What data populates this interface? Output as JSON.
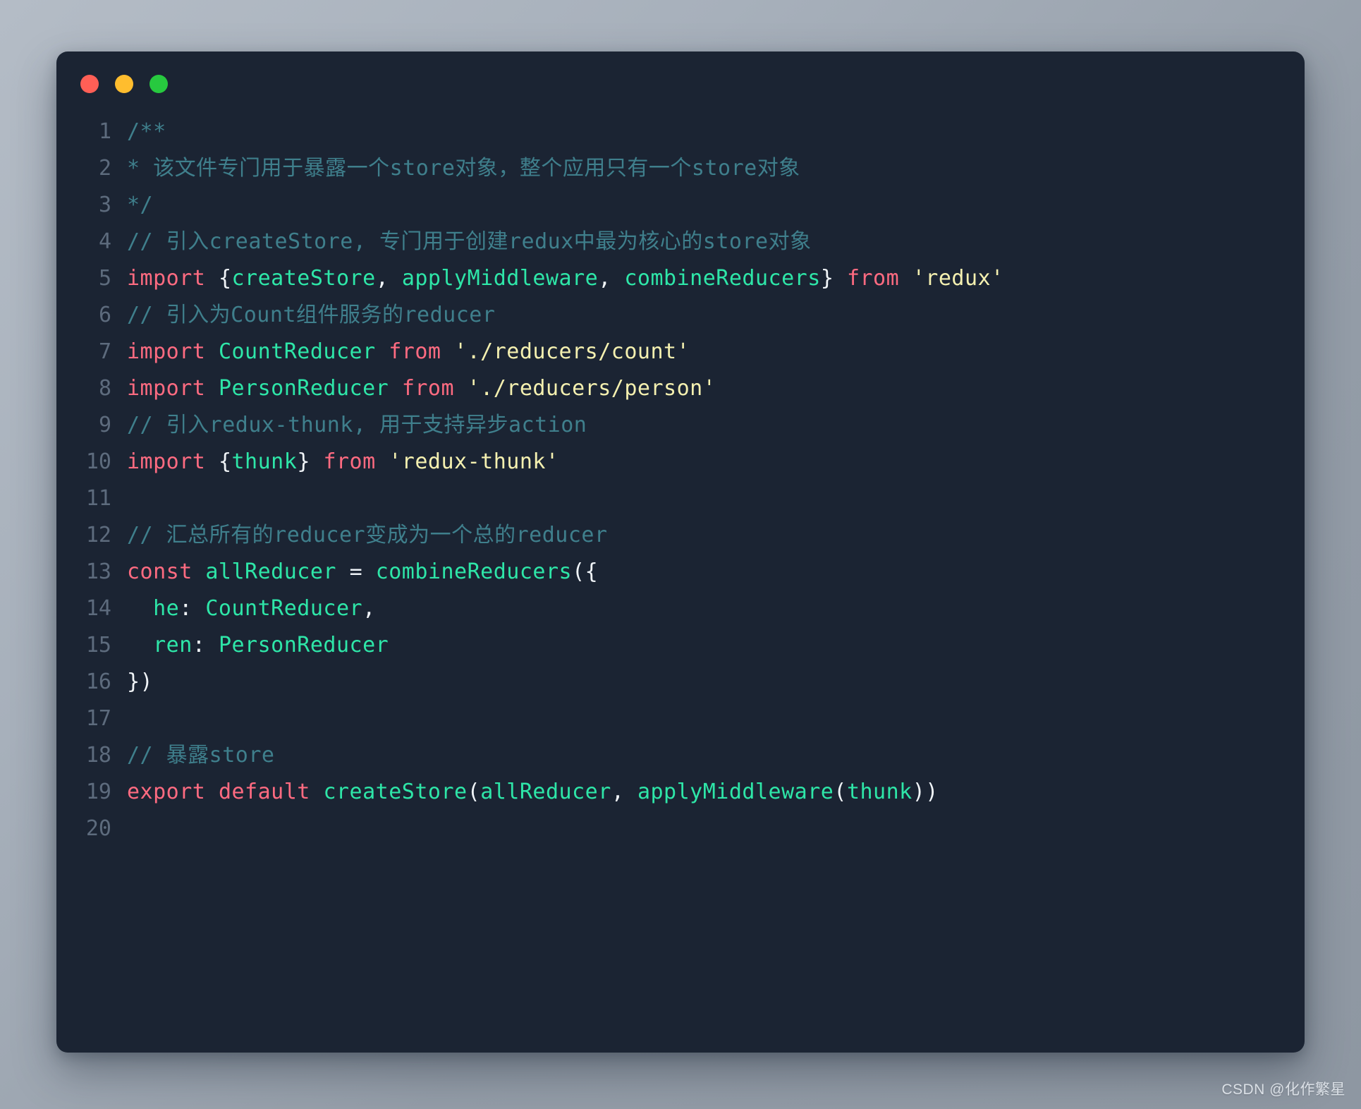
{
  "window": {
    "background_color": "#1b2433",
    "traffic_lights": [
      {
        "name": "close",
        "color": "#ff5f56",
        "label": ""
      },
      {
        "name": "minimize",
        "color": "#ffbd2e",
        "label": ""
      },
      {
        "name": "maximize",
        "color": "#27c93f",
        "label": ""
      }
    ]
  },
  "editor": {
    "language": "javascript",
    "theme": "dark-navy",
    "total_lines": 20,
    "lines": [
      {
        "number": "1",
        "text": "/**",
        "tokens": [
          {
            "t": "/**",
            "c": "comment"
          }
        ]
      },
      {
        "number": "2",
        "text": "* 该文件专门用于暴露一个store对象，整个应用只有一个store对象",
        "tokens": [
          {
            "t": "* 该文件专门用于暴露一个store对象，整个应用只有一个store对象",
            "c": "comment"
          }
        ]
      },
      {
        "number": "3",
        "text": "*/",
        "tokens": [
          {
            "t": "*/",
            "c": "comment"
          }
        ]
      },
      {
        "number": "4",
        "text": "// 引入createStore, 专门用于创建redux中最为核心的store对象",
        "tokens": [
          {
            "t": "// 引入createStore, 专门用于创建redux中最为核心的store对象",
            "c": "comment"
          }
        ]
      },
      {
        "number": "5",
        "text": "import {createStore, applyMiddleware, combineReducers} from 'redux'",
        "tokens": [
          {
            "t": "import",
            "c": "keyword"
          },
          {
            "t": " ",
            "c": "plain"
          },
          {
            "t": "{",
            "c": "punct"
          },
          {
            "t": "createStore",
            "c": "ident"
          },
          {
            "t": ",",
            "c": "punct"
          },
          {
            "t": " ",
            "c": "plain"
          },
          {
            "t": "applyMiddleware",
            "c": "ident"
          },
          {
            "t": ",",
            "c": "punct"
          },
          {
            "t": " ",
            "c": "plain"
          },
          {
            "t": "combineReducers",
            "c": "ident"
          },
          {
            "t": "}",
            "c": "punct"
          },
          {
            "t": " ",
            "c": "plain"
          },
          {
            "t": "from",
            "c": "keyword"
          },
          {
            "t": " ",
            "c": "plain"
          },
          {
            "t": "'redux'",
            "c": "string"
          }
        ]
      },
      {
        "number": "6",
        "text": "// 引入为Count组件服务的reducer",
        "tokens": [
          {
            "t": "// 引入为Count组件服务的reducer",
            "c": "comment"
          }
        ]
      },
      {
        "number": "7",
        "text": "import CountReducer from './reducers/count'",
        "tokens": [
          {
            "t": "import",
            "c": "keyword"
          },
          {
            "t": " ",
            "c": "plain"
          },
          {
            "t": "CountReducer",
            "c": "ident"
          },
          {
            "t": " ",
            "c": "plain"
          },
          {
            "t": "from",
            "c": "keyword"
          },
          {
            "t": " ",
            "c": "plain"
          },
          {
            "t": "'./reducers/count'",
            "c": "string"
          }
        ]
      },
      {
        "number": "8",
        "text": "import PersonReducer from './reducers/person'",
        "tokens": [
          {
            "t": "import",
            "c": "keyword"
          },
          {
            "t": " ",
            "c": "plain"
          },
          {
            "t": "PersonReducer",
            "c": "ident"
          },
          {
            "t": " ",
            "c": "plain"
          },
          {
            "t": "from",
            "c": "keyword"
          },
          {
            "t": " ",
            "c": "plain"
          },
          {
            "t": "'./reducers/person'",
            "c": "string"
          }
        ]
      },
      {
        "number": "9",
        "text": "// 引入redux-thunk, 用于支持异步action",
        "tokens": [
          {
            "t": "// 引入redux-thunk, 用于支持异步action",
            "c": "comment"
          }
        ]
      },
      {
        "number": "10",
        "text": "import {thunk} from 'redux-thunk'",
        "tokens": [
          {
            "t": "import",
            "c": "keyword"
          },
          {
            "t": " ",
            "c": "plain"
          },
          {
            "t": "{",
            "c": "punct"
          },
          {
            "t": "thunk",
            "c": "ident"
          },
          {
            "t": "}",
            "c": "punct"
          },
          {
            "t": " ",
            "c": "plain"
          },
          {
            "t": "from",
            "c": "keyword"
          },
          {
            "t": " ",
            "c": "plain"
          },
          {
            "t": "'redux-thunk'",
            "c": "string"
          }
        ]
      },
      {
        "number": "11",
        "text": "",
        "tokens": []
      },
      {
        "number": "12",
        "text": "// 汇总所有的reducer变成为一个总的reducer",
        "tokens": [
          {
            "t": "// 汇总所有的reducer变成为一个总的reducer",
            "c": "comment"
          }
        ]
      },
      {
        "number": "13",
        "text": "const allReducer = combineReducers({",
        "tokens": [
          {
            "t": "const",
            "c": "keyword"
          },
          {
            "t": " ",
            "c": "plain"
          },
          {
            "t": "allReducer",
            "c": "ident"
          },
          {
            "t": " ",
            "c": "plain"
          },
          {
            "t": "=",
            "c": "punct"
          },
          {
            "t": " ",
            "c": "plain"
          },
          {
            "t": "combineReducers",
            "c": "func"
          },
          {
            "t": "({",
            "c": "punct"
          }
        ]
      },
      {
        "number": "14",
        "text": "  he: CountReducer,",
        "tokens": [
          {
            "t": "  ",
            "c": "plain"
          },
          {
            "t": "he",
            "c": "ident"
          },
          {
            "t": ":",
            "c": "punct"
          },
          {
            "t": " ",
            "c": "plain"
          },
          {
            "t": "CountReducer",
            "c": "ident"
          },
          {
            "t": ",",
            "c": "punct"
          }
        ]
      },
      {
        "number": "15",
        "text": "  ren: PersonReducer",
        "tokens": [
          {
            "t": "  ",
            "c": "plain"
          },
          {
            "t": "ren",
            "c": "ident"
          },
          {
            "t": ":",
            "c": "punct"
          },
          {
            "t": " ",
            "c": "plain"
          },
          {
            "t": "PersonReducer",
            "c": "ident"
          }
        ]
      },
      {
        "number": "16",
        "text": "})",
        "tokens": [
          {
            "t": "})",
            "c": "punct"
          }
        ]
      },
      {
        "number": "17",
        "text": "",
        "tokens": []
      },
      {
        "number": "18",
        "text": "// 暴露store",
        "tokens": [
          {
            "t": "// 暴露store",
            "c": "comment"
          }
        ]
      },
      {
        "number": "19",
        "text": "export default createStore(allReducer, applyMiddleware(thunk))",
        "tokens": [
          {
            "t": "export",
            "c": "keyword"
          },
          {
            "t": " ",
            "c": "plain"
          },
          {
            "t": "default",
            "c": "keyword"
          },
          {
            "t": " ",
            "c": "plain"
          },
          {
            "t": "createStore",
            "c": "func"
          },
          {
            "t": "(",
            "c": "punct"
          },
          {
            "t": "allReducer",
            "c": "ident"
          },
          {
            "t": ",",
            "c": "punct"
          },
          {
            "t": " ",
            "c": "plain"
          },
          {
            "t": "applyMiddleware",
            "c": "func"
          },
          {
            "t": "(",
            "c": "punct"
          },
          {
            "t": "thunk",
            "c": "ident"
          },
          {
            "t": "))",
            "c": "punct"
          }
        ]
      },
      {
        "number": "20",
        "text": "",
        "tokens": []
      }
    ]
  },
  "watermark": {
    "text": "CSDN @化作繁星"
  },
  "colors": {
    "comment": "#3f7f8c",
    "keyword": "#ff6b81",
    "identifier": "#2ee6a8",
    "string": "#f4f0b0",
    "punctuation": "#f0f4f8",
    "gutter": "#5d6b7d",
    "editor_background": "#1b2433"
  }
}
